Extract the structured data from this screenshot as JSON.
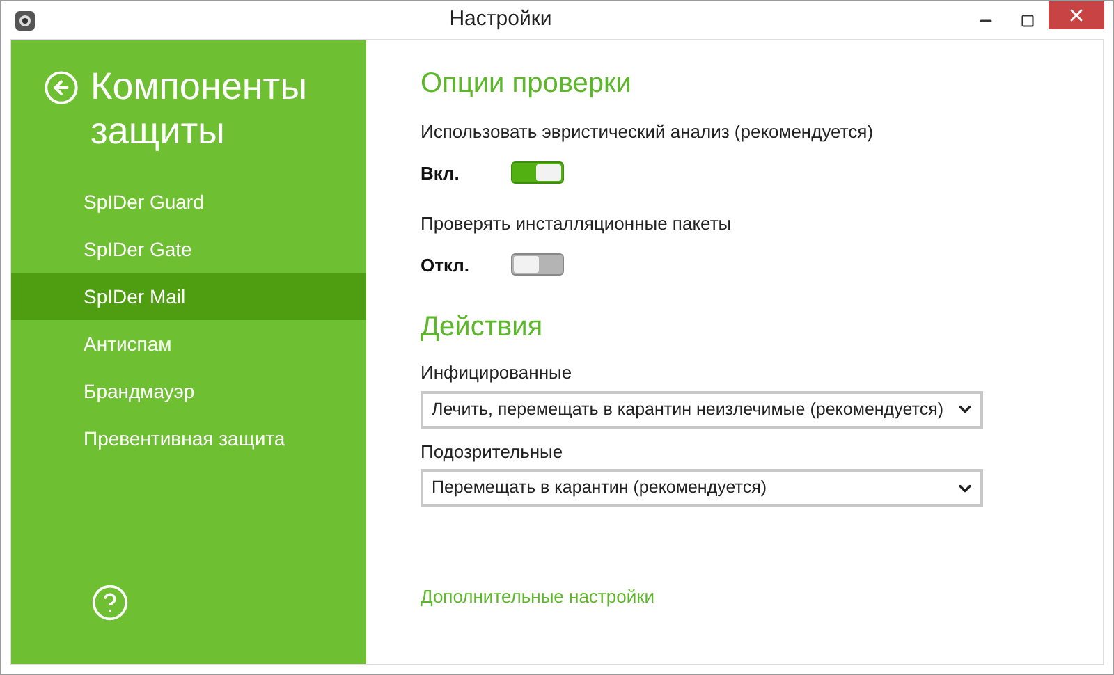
{
  "window": {
    "title": "Настройки"
  },
  "sidebar": {
    "title": "Компоненты защиты",
    "items": [
      {
        "label": "SpIDer Guard",
        "selected": false
      },
      {
        "label": "SpIDer Gate",
        "selected": false
      },
      {
        "label": "SpIDer Mail",
        "selected": true
      },
      {
        "label": "Антиспам",
        "selected": false
      },
      {
        "label": "Брандмауэр",
        "selected": false
      },
      {
        "label": "Превентивная защита",
        "selected": false
      }
    ]
  },
  "scan_options": {
    "title": "Опции проверки",
    "options": [
      {
        "label": "Использовать эвристический анализ (рекомендуется)",
        "state": "Вкл.",
        "on": true
      },
      {
        "label": "Проверять инсталляционные пакеты",
        "state": "Откл.",
        "on": false
      }
    ]
  },
  "actions": {
    "title": "Действия",
    "fields": [
      {
        "label": "Инфицированные",
        "value": "Лечить, перемещать в карантин неизлечимые (рекомендуется)"
      },
      {
        "label": "Подозрительные",
        "value": "Перемещать в карантин (рекомендуется)"
      }
    ]
  },
  "advanced_link": "Дополнительные настройки"
}
